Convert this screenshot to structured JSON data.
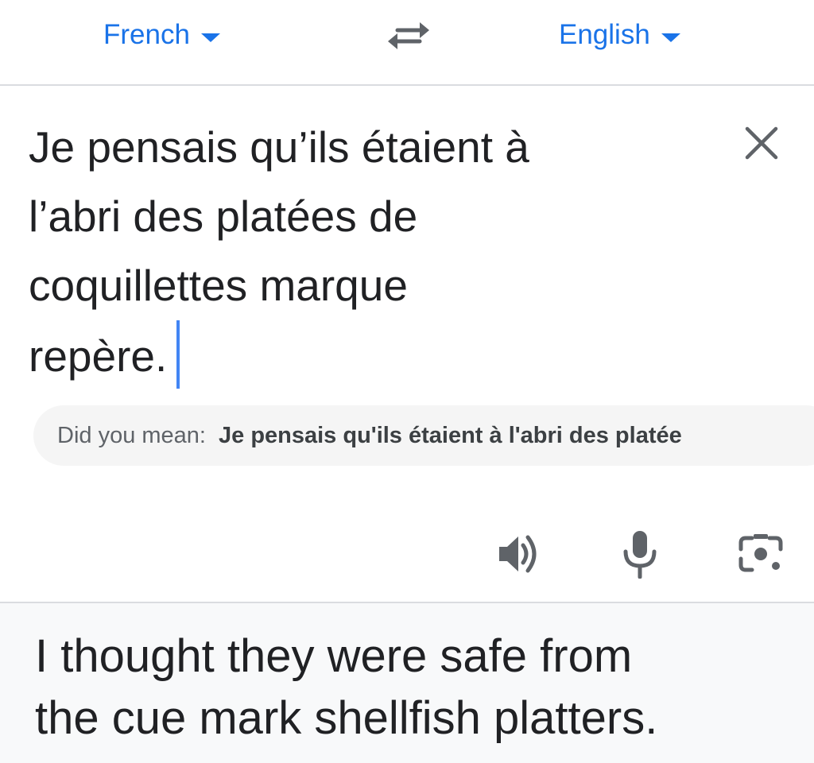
{
  "lang_bar": {
    "source_language": "French",
    "target_language": "English"
  },
  "source": {
    "lines": [
      "Je pensais qu’ils étaient à",
      "l’abri des platées de",
      "coquillettes marque",
      "repère."
    ]
  },
  "suggestion": {
    "label": "Did you mean:",
    "value": "Je pensais qu'ils étaient à l'abri des platée"
  },
  "translation": {
    "lines": [
      "I thought they were safe from",
      "the cue mark shellfish platters."
    ]
  },
  "icons": {
    "swap": "swap-languages-icon",
    "clear": "close-icon",
    "speaker": "speaker-icon",
    "mic": "microphone-icon",
    "camera": "camera-icon"
  },
  "colors": {
    "accent": "#1a73e8",
    "cursor": "#4285f4",
    "text": "#202124",
    "icon": "#5f6368"
  }
}
